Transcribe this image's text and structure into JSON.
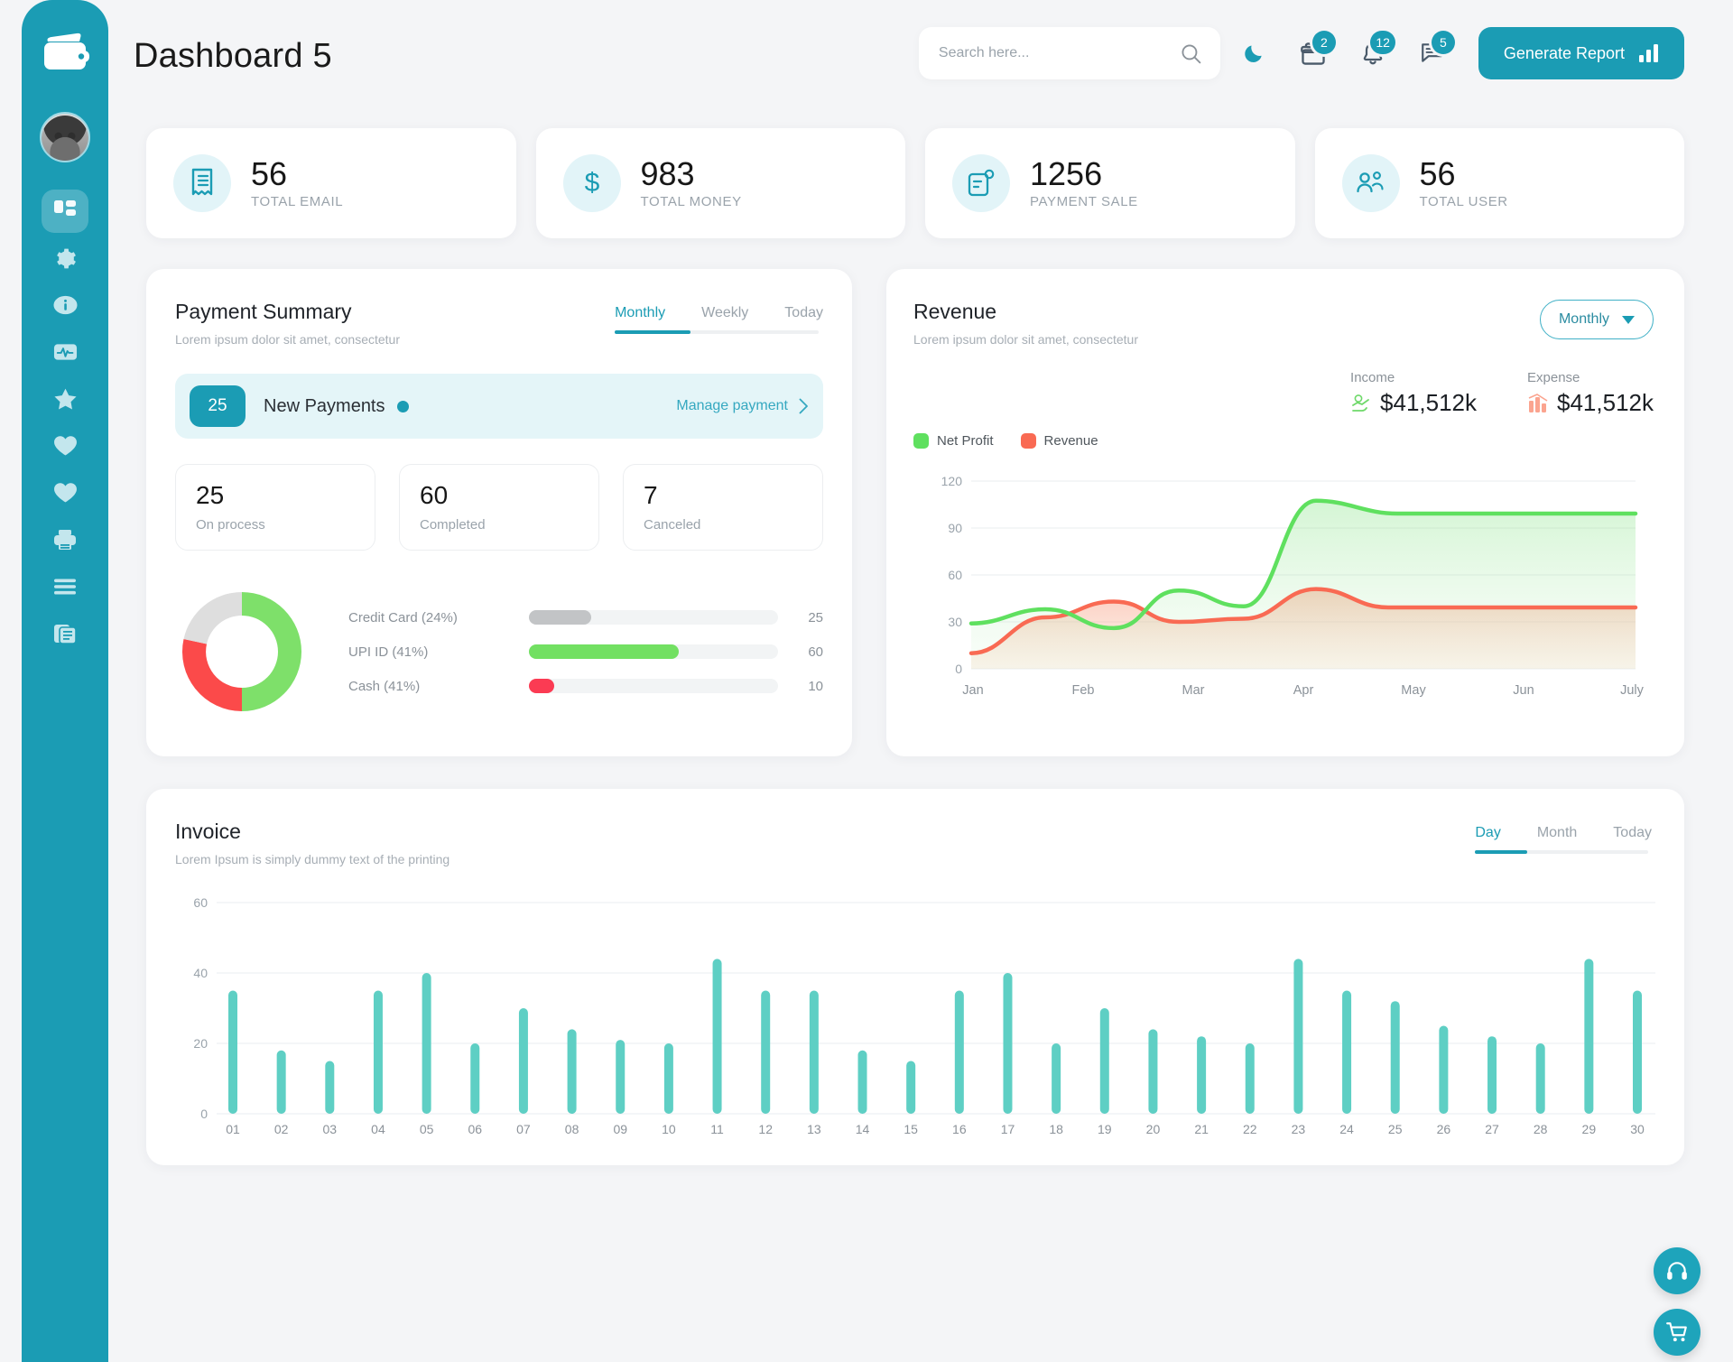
{
  "header": {
    "title": "Dashboard 5",
    "search": {
      "placeholder": "Search here...",
      "value": ""
    },
    "dark_mode_icon": "moon-icon",
    "gift": {
      "icon": "gift-icon",
      "badge": "2"
    },
    "notifications": {
      "icon": "bell-icon",
      "badge": "12"
    },
    "messages": {
      "icon": "chat-icon",
      "badge": "5"
    },
    "generate_report": "Generate Report"
  },
  "sidebar": {
    "logo_icon": "wallet-logo-icon",
    "avatar": "user-avatar",
    "items": [
      {
        "icon": "dashboard-grid-icon",
        "active": true
      },
      {
        "icon": "gear-icon",
        "active": false
      },
      {
        "icon": "info-icon",
        "active": false
      },
      {
        "icon": "analytics-pulse-icon",
        "active": false
      },
      {
        "icon": "star-icon",
        "active": false
      },
      {
        "icon": "heart-icon",
        "active": false
      },
      {
        "icon": "heart-filled-icon",
        "active": false
      },
      {
        "icon": "printer-icon",
        "active": false
      },
      {
        "icon": "menu-lines-icon",
        "active": false
      },
      {
        "icon": "documents-icon",
        "active": false
      }
    ]
  },
  "stats": [
    {
      "value": "56",
      "label": "TOTAL EMAIL",
      "icon": "receipt-icon"
    },
    {
      "value": "983",
      "label": "TOTAL MONEY",
      "icon": "dollar-icon"
    },
    {
      "value": "1256",
      "label": "PAYMENT SALE",
      "icon": "invoice-icon"
    },
    {
      "value": "56",
      "label": "TOTAL USER",
      "icon": "users-icon"
    }
  ],
  "payment_summary": {
    "title": "Payment Summary",
    "subtitle": "Lorem ipsum dolor sit amet, consectetur",
    "tabs": [
      {
        "label": "Monthly",
        "active": true
      },
      {
        "label": "Weekly",
        "active": false
      },
      {
        "label": "Today",
        "active": false
      }
    ],
    "new_payments": {
      "count": "25",
      "label": "New Payments",
      "link": "Manage payment"
    },
    "mini_stats": [
      {
        "value": "25",
        "label": "On process"
      },
      {
        "value": "60",
        "label": "Completed"
      },
      {
        "value": "7",
        "label": "Canceled"
      }
    ],
    "chart_data": {
      "type": "pie",
      "title": "Payment Methods",
      "labels": [
        "Credit Card (24%)",
        "UPI ID (41%)",
        "Cash (41%)"
      ],
      "values": [
        25,
        60,
        10
      ],
      "percents": [
        24,
        41,
        41
      ],
      "colors": [
        "#c2c4c6",
        "#72e062",
        "#fb3b53"
      ],
      "donut_segments": [
        {
          "name": "UPI ID",
          "color": "#72e062",
          "percent": 50
        },
        {
          "name": "Cash",
          "color": "#fb4a4a",
          "percent": 36
        },
        {
          "name": "Credit Card",
          "color": "#dedede",
          "percent": 14
        }
      ],
      "bar_fill_percent": [
        25,
        60,
        10
      ]
    }
  },
  "revenue": {
    "title": "Revenue",
    "subtitle": "Lorem ipsum dolor sit amet, consectetur",
    "dropdown": "Monthly",
    "income": {
      "label": "Income",
      "value": "$41,512k",
      "icon": "money-hand-icon"
    },
    "expense": {
      "label": "Expense",
      "value": "$41,512k",
      "icon": "coins-icon"
    },
    "chart_data": {
      "type": "area",
      "title": "Revenue",
      "xlabel": "",
      "ylabel": "",
      "ylim": [
        0,
        120
      ],
      "yticks": [
        0,
        30,
        60,
        90,
        120
      ],
      "grid": true,
      "legend_position": "top-left",
      "categories": [
        "Jan",
        "Feb",
        "Mar",
        "Apr",
        "May",
        "Jun",
        "July"
      ],
      "series": [
        {
          "name": "Net Profit",
          "color": "#5fe05f",
          "values": [
            29,
            38,
            26,
            50,
            40,
            108,
            99
          ]
        },
        {
          "name": "Revenue",
          "color": "#f96a53",
          "values": [
            10,
            30,
            43,
            30,
            32,
            51,
            39
          ]
        }
      ]
    }
  },
  "invoice": {
    "title": "Invoice",
    "subtitle": "Lorem Ipsum is simply dummy text of the printing",
    "tabs": [
      {
        "label": "Day",
        "active": true
      },
      {
        "label": "Month",
        "active": false
      },
      {
        "label": "Today",
        "active": false
      }
    ],
    "chart_data": {
      "type": "bar",
      "title": "Invoice",
      "xlabel": "",
      "ylabel": "",
      "ylim": [
        0,
        60
      ],
      "yticks": [
        0,
        20,
        40,
        60
      ],
      "grid": true,
      "bar_color": "#5ecfc4",
      "categories": [
        "01",
        "02",
        "03",
        "04",
        "05",
        "06",
        "07",
        "08",
        "09",
        "10",
        "11",
        "12",
        "13",
        "14",
        "15",
        "16",
        "17",
        "18",
        "19",
        "20",
        "21",
        "22",
        "23",
        "24",
        "25",
        "26",
        "27",
        "28",
        "29",
        "30"
      ],
      "values": [
        35,
        18,
        15,
        35,
        40,
        20,
        30,
        24,
        21,
        20,
        44,
        35,
        35,
        18,
        15,
        35,
        40,
        20,
        30,
        24,
        22,
        20,
        44,
        35,
        32,
        25,
        22,
        20,
        44,
        35
      ]
    }
  },
  "floating": {
    "support_icon": "headset-icon",
    "cart_icon": "cart-icon"
  },
  "colors": {
    "accent": "#1b9cb4",
    "green": "#5fe05f",
    "red": "#f96a53",
    "teal_bar": "#5ecfc4",
    "page_bg": "#f4f5f7"
  }
}
